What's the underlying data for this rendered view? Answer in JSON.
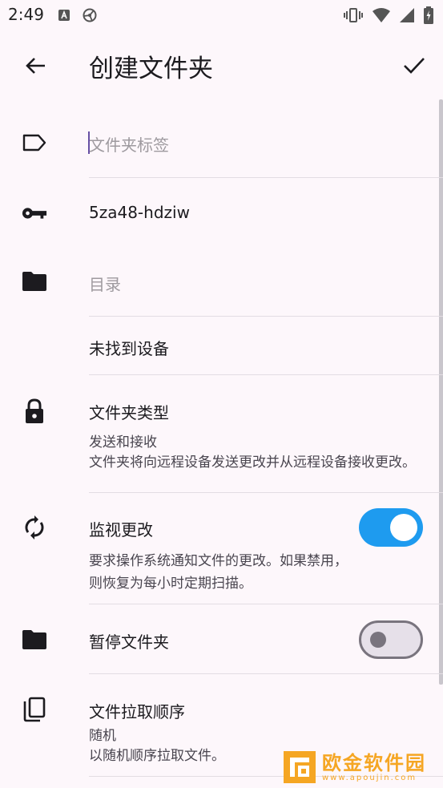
{
  "status_bar": {
    "time": "2:49"
  },
  "app_bar": {
    "title": "创建文件夹"
  },
  "form": {
    "label_placeholder": "文件夹标签",
    "folder_id": "5za48-hdziw",
    "directory_placeholder": "目录",
    "no_device": "未找到设备",
    "folder_type": {
      "title": "文件夹类型",
      "value": "发送和接收",
      "description": "文件夹将向远程设备发送更改并从远程设备接收更改。"
    },
    "watch_changes": {
      "title": "监视更改",
      "description_line1": "要求操作系统通知文件的更改。如果禁用，",
      "description_line2": "则恢复为每小时定期扫描。",
      "enabled": true
    },
    "pause_folder": {
      "title": "暂停文件夹",
      "enabled": false
    },
    "pull_order": {
      "title": "文件拉取顺序",
      "value": "随机",
      "description": "以随机顺序拉取文件。"
    }
  },
  "watermark": {
    "text": "欧金软件园",
    "url": "www.apoujin.com"
  },
  "colors": {
    "accent": "#1e9bef",
    "background": "#fdf7fb",
    "watermark": "#f5a623"
  }
}
